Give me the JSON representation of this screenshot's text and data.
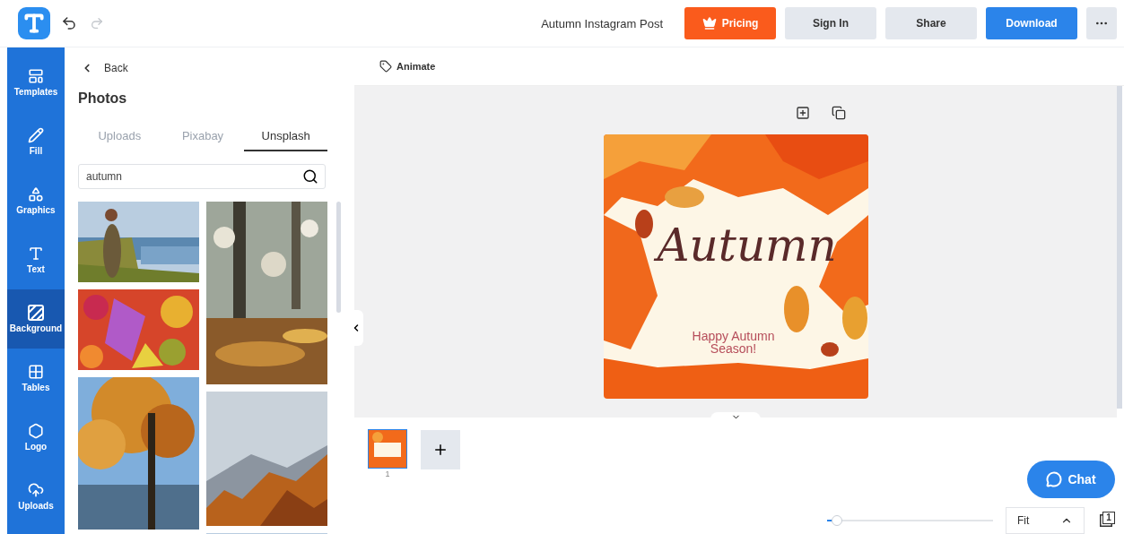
{
  "header": {
    "title": "Autumn Instagram Post",
    "pricing": "Pricing",
    "sign_in": "Sign In",
    "share": "Share",
    "download": "Download",
    "undo_disabled": false,
    "redo_disabled": true
  },
  "sidebar": {
    "items": [
      {
        "label": "Templates",
        "kind": "templates",
        "selected": false
      },
      {
        "label": "Fill",
        "kind": "fill",
        "selected": false
      },
      {
        "label": "Graphics",
        "kind": "graphics",
        "selected": false
      },
      {
        "label": "Text",
        "kind": "text",
        "selected": false
      },
      {
        "label": "Background",
        "kind": "background",
        "selected": true
      },
      {
        "label": "Tables",
        "kind": "tables",
        "selected": false
      },
      {
        "label": "Logo",
        "kind": "logo",
        "selected": false
      },
      {
        "label": "Uploads",
        "kind": "uploads",
        "selected": false
      }
    ]
  },
  "panel": {
    "back": "Back",
    "title": "Photos",
    "tabs": [
      {
        "label": "Uploads",
        "selected": false
      },
      {
        "label": "Pixabay",
        "selected": false
      },
      {
        "label": "Unsplash",
        "selected": true
      }
    ],
    "search": {
      "value": "autumn"
    }
  },
  "toolbar": {
    "animate": "Animate"
  },
  "design": {
    "script_title": "Autumn",
    "subtitle": "Happy Autumn Season!"
  },
  "pages": [
    {
      "number": "1",
      "selected": true
    }
  ],
  "chat": "Chat",
  "zoom": {
    "level": 0.06,
    "fit": "Fit",
    "pages_count": "1"
  }
}
